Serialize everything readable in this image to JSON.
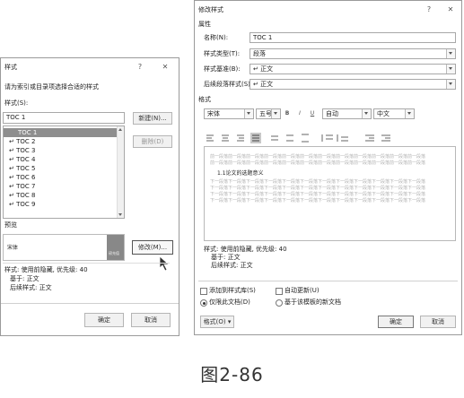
{
  "left_dialog": {
    "title": "样式",
    "help_icon": "?",
    "close_icon": "✕",
    "instruction": "请为索引或目录项选择合适的样式",
    "styles_label": "样式(S):",
    "style_input_value": "TOC 1",
    "new_button": "新建(N)...",
    "delete_button": "删除(D)",
    "style_list": [
      "TOC 1",
      "↵ TOC 2",
      "↵ TOC 3",
      "↵ TOC 4",
      "↵ TOC 5",
      "↵ TOC 6",
      "↵ TOC 7",
      "↵ TOC 8",
      "↵ TOC 9"
    ],
    "preview_label": "预览",
    "preview_font": "宋体",
    "preview_size": "磅充值",
    "modify_button": "修改(M)...",
    "desc_line1": "样式: 使用前隐藏, 优先级: 40",
    "desc_line2": "基于: 正文",
    "desc_line3": "后续样式: 正文",
    "ok_button": "确定",
    "cancel_button": "取消"
  },
  "right_dialog": {
    "title": "修改样式",
    "help_icon": "?",
    "close_icon": "✕",
    "properties_label": "属性",
    "name_label": "名称(N):",
    "name_value": "TOC 1",
    "type_label": "样式类型(T):",
    "type_value": "段落",
    "based_label": "样式基准(B):",
    "based_value": "↵ 正文",
    "next_label": "后续段落样式(S):",
    "next_value": "↵ 正文",
    "format_label": "格式",
    "font_value": "宋体",
    "size_value": "五号",
    "bold": "B",
    "italic": "I",
    "underline": "U",
    "color_value": "自动",
    "lang_value": "中文",
    "preview_prev_text": "前一段落前一段落前一段落前一段落前一段落前一段落前一段落前一段落前一段落前一段落前一段落前一段落",
    "preview_sample": "1.1论文的选题意义",
    "preview_next_text": "下一段落下一段落下一段落下一段落下一段落下一段落下一段落下一段落下一段落下一段落下一段落下一段落",
    "desc_line1": "样式: 使用前隐藏, 优先级: 40",
    "desc_line2": "基于: 正文",
    "desc_line3": "后续样式: 正文",
    "add_gallery": "添加到样式库(S)",
    "auto_update": "自动更新(U)",
    "only_this_doc": "仅限此文档(D)",
    "new_docs": "基于该模板的新文档",
    "format_button": "格式(O) ▾",
    "ok_button": "确定",
    "cancel_button": "取消"
  },
  "caption": "图2-86"
}
